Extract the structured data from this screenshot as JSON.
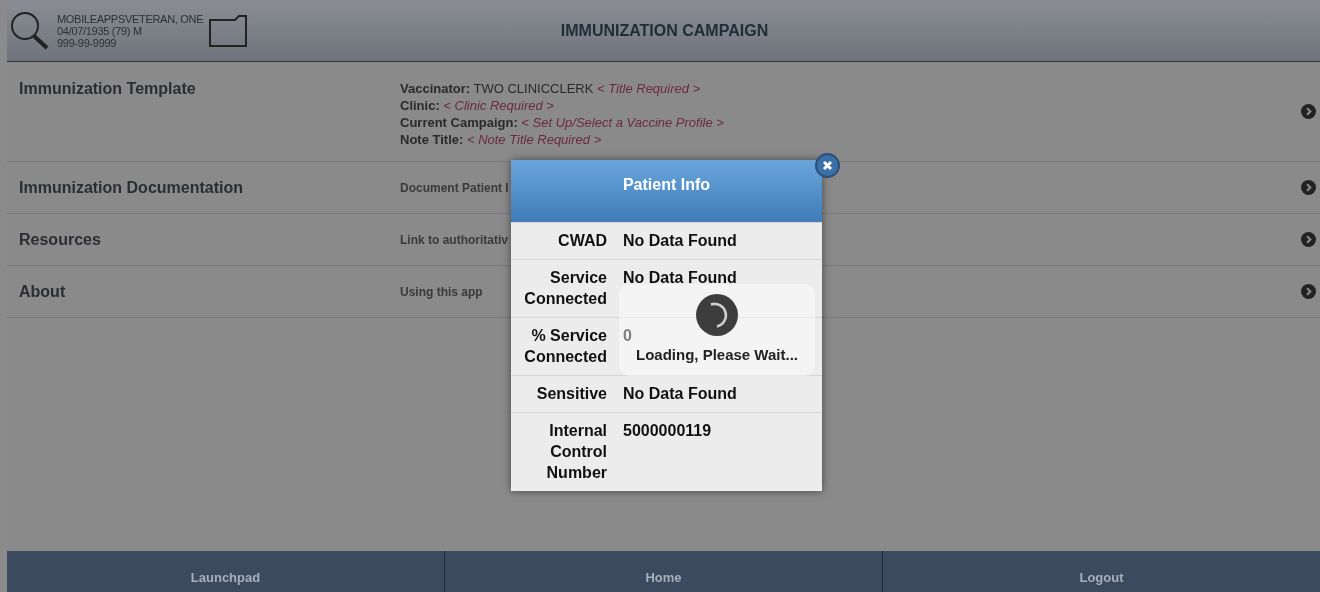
{
  "patient": {
    "name": "MOBILEAPPSVETERAN, ONE",
    "dob": "04/07/1935 (79) M",
    "ssn": "999-99-9999"
  },
  "title": "IMMUNIZATION CAMPAIGN",
  "menu": [
    {
      "title": "Immunization Template",
      "details": [
        {
          "label": "Vaccinator:",
          "value": "TWO CLINICCLERK",
          "note": "< Title Required >"
        },
        {
          "label": "Clinic:",
          "note": "< Clinic Required >"
        },
        {
          "label": "Current Campaign:",
          "note": "< Set Up/Select a Vaccine Profile >"
        },
        {
          "label": "Note Title:",
          "note": "< Note Title Required >"
        }
      ]
    },
    {
      "title": "Immunization Documentation",
      "description": "Document Patient I"
    },
    {
      "title": "Resources",
      "description": "Link to authoritativ"
    },
    {
      "title": "About",
      "description": "Using this app"
    }
  ],
  "dialog": {
    "title": "Patient Info",
    "rows": [
      {
        "label": "CWAD",
        "value": "No Data Found"
      },
      {
        "label": "Service Connected",
        "value": "No Data Found"
      },
      {
        "label": "% Service Connected",
        "value": "0"
      },
      {
        "label": "Sensitive",
        "value": "No Data Found"
      },
      {
        "label": "Internal Control Number",
        "value": "5000000119"
      }
    ],
    "loading": {
      "message": "Loading, Please Wait..."
    }
  },
  "footer": [
    "Launchpad",
    "Home",
    "Logout"
  ]
}
